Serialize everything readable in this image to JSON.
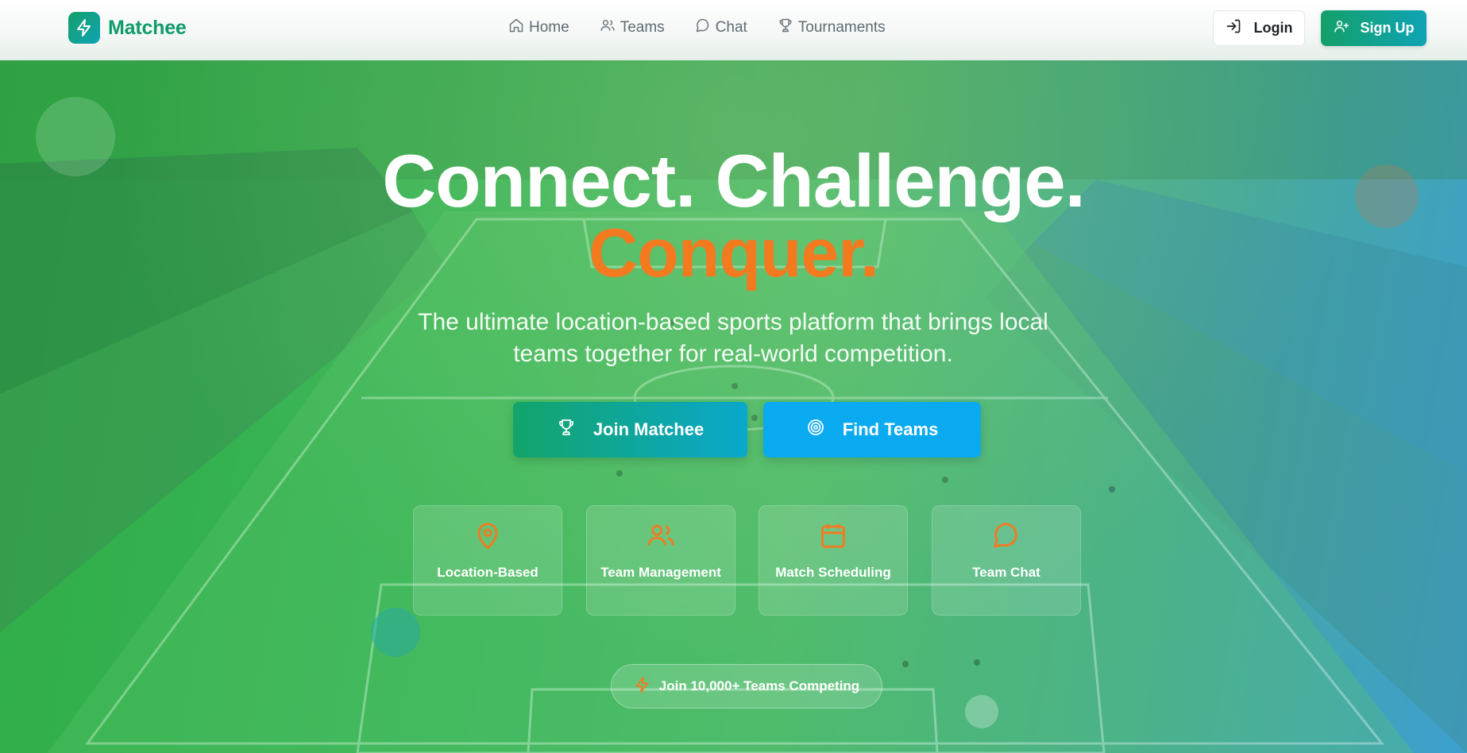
{
  "brand": {
    "name": "Matchee",
    "logo_icon": "bolt-icon",
    "color": "#0f9b6a"
  },
  "nav": {
    "links": [
      {
        "label": "Home",
        "icon": "home-icon"
      },
      {
        "label": "Teams",
        "icon": "users-icon"
      },
      {
        "label": "Chat",
        "icon": "chat-icon"
      },
      {
        "label": "Tournaments",
        "icon": "trophy-icon"
      }
    ],
    "login_label": "Login",
    "signup_label": "Sign Up"
  },
  "hero": {
    "headline_line1": "Connect. Challenge.",
    "headline_line2": "Conquer.",
    "subtitle": "The ultimate location-based sports platform that brings local teams together for real-world competition.",
    "primary_cta": "Join Matchee",
    "secondary_cta": "Find Teams",
    "features": [
      {
        "label": "Location-Based",
        "icon": "map-pin-icon"
      },
      {
        "label": "Team Management",
        "icon": "users-icon"
      },
      {
        "label": "Match Scheduling",
        "icon": "calendar-icon"
      },
      {
        "label": "Team Chat",
        "icon": "chat-icon"
      }
    ],
    "badge": "Join 10,000+ Teams Competing"
  },
  "colors": {
    "accent_orange": "#f47a20",
    "primary_green": "#14a06a",
    "secondary_blue": "#0aaaf0"
  }
}
